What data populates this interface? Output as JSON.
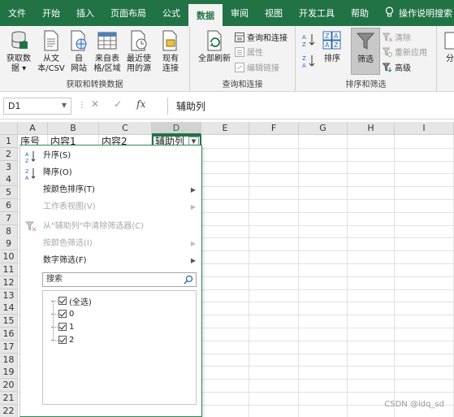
{
  "tabs": [
    "文件",
    "开始",
    "插入",
    "页面布局",
    "公式",
    "数据",
    "审阅",
    "视图",
    "开发工具",
    "帮助",
    "操作说明搜索"
  ],
  "active_tab": "数据",
  "ribbon": {
    "get_data": {
      "label": "获取和转换数据",
      "buttons": [
        "获取数\n据 ▾",
        "从文\n本/CSV",
        "自\n网站",
        "来自表\n格/区域",
        "最近使\n用的源",
        "现有\n连接"
      ]
    },
    "queries": {
      "label": "查询和连接",
      "refresh_all": "全部刷新",
      "queries_connections": "查询和连接",
      "properties": "属性",
      "edit_links": "编辑链接"
    },
    "sort_filter": {
      "label": "排序和筛选",
      "sort": "排序",
      "filter": "筛选",
      "clear": "清除",
      "reapply": "重新应用",
      "advanced": "高级",
      "more": "分"
    }
  },
  "formula_bar": {
    "name_box": "D1",
    "content": "辅助列"
  },
  "grid": {
    "columns": [
      "A",
      "B",
      "C",
      "D",
      "E",
      "F",
      "G",
      "H",
      "I"
    ],
    "rows": [
      "1",
      "2",
      "3",
      "4",
      "5",
      "6",
      "7",
      "8",
      "9",
      "10",
      "11",
      "12",
      "13",
      "14",
      "15",
      "16",
      "17",
      "18",
      "19",
      "20",
      "21",
      "22"
    ],
    "row1": [
      "序号",
      "内容1",
      "内容2",
      "辅助列"
    ]
  },
  "filter_menu": {
    "items": [
      {
        "label": "升序(S)",
        "disabled": false,
        "submenu": false
      },
      {
        "label": "降序(O)",
        "disabled": false,
        "submenu": false
      },
      {
        "label": "按颜色排序(T)",
        "disabled": false,
        "submenu": true
      },
      {
        "label": "工作表视图(V)",
        "disabled": true,
        "submenu": true
      },
      {
        "label": "从\"辅助列\"中清除筛选器(C)",
        "disabled": true,
        "submenu": false
      },
      {
        "label": "按颜色筛选(I)",
        "disabled": true,
        "submenu": true
      },
      {
        "label": "数字筛选(F)",
        "disabled": false,
        "submenu": true
      }
    ],
    "search_placeholder": "搜索",
    "checklist": [
      "(全选)",
      "0",
      "1",
      "2"
    ]
  },
  "watermark": "CSDN @ldq_sd",
  "colors": {
    "excel_green": "#217346",
    "ribbon_bg": "#f3f3f3",
    "header_bg": "#e6e6e6"
  }
}
